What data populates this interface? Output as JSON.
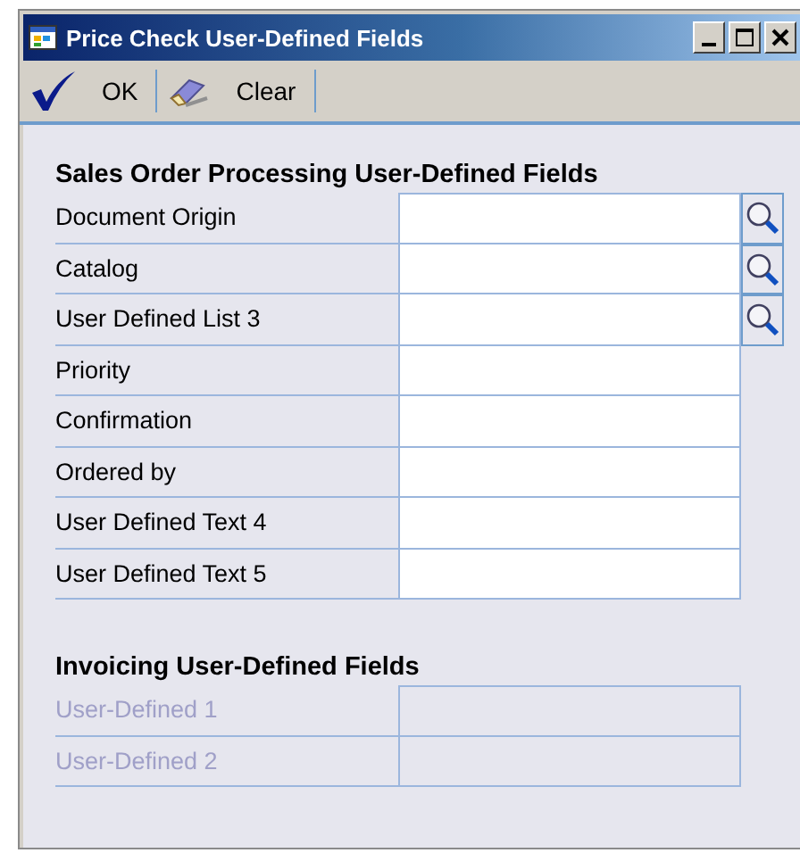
{
  "window": {
    "title": "Price Check User-Defined Fields"
  },
  "toolbar": [
    {
      "kind": "ok",
      "label": "OK"
    },
    {
      "kind": "clear",
      "label": "Clear"
    }
  ],
  "sections": [
    {
      "title": "Sales Order Processing User-Defined Fields",
      "fields": [
        {
          "label": "Document Origin",
          "kind": "lookup",
          "disabled": false
        },
        {
          "label": "Catalog",
          "kind": "lookup",
          "disabled": false
        },
        {
          "label": "User Defined List 3",
          "kind": "lookup",
          "disabled": false
        },
        {
          "label": "Priority",
          "kind": "text",
          "disabled": false
        },
        {
          "label": "Confirmation",
          "kind": "text",
          "disabled": false
        },
        {
          "label": "Ordered by",
          "kind": "text",
          "disabled": false
        },
        {
          "label": "User Defined Text 4",
          "kind": "text",
          "disabled": false
        },
        {
          "label": "User Defined Text 5",
          "kind": "text",
          "disabled": false
        }
      ]
    },
    {
      "title": "Invoicing User-Defined Fields",
      "fields": [
        {
          "label": "User-Defined 1",
          "kind": "text",
          "disabled": true
        },
        {
          "label": "User-Defined 2",
          "kind": "text",
          "disabled": true
        }
      ]
    }
  ]
}
